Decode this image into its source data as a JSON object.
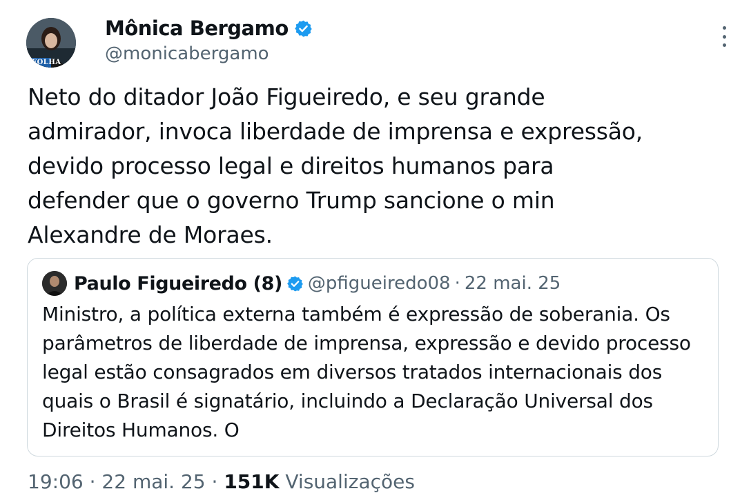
{
  "author": {
    "display_name": "Mônica Bergamo",
    "handle": "@monicabergamo",
    "avatar_badge": "FOLHA",
    "verified_color": "#1d9bf0"
  },
  "tweet": {
    "lines": [
      "Neto do ditador João Figueiredo, e seu grande",
      "admirador, invoca liberdade de imprensa e expressão,",
      "devido processo legal e direitos humanos para",
      "defender que o governo Trump sancione o min",
      "Alexandre de Moraes."
    ]
  },
  "quote": {
    "display_name": "Paulo Figueiredo (8)",
    "handle": "@pfigueiredo08",
    "separator": "·",
    "date": "22 mai. 25",
    "lines": [
      "Ministro, a política externa também é expressão de soberania. Os",
      "parâmetros de liberdade de imprensa, expressão e devido processo",
      "legal estão consagrados em diversos tratados internacionais dos",
      "quais o Brasil é signatário, incluindo a Declaração Universal dos",
      "Direitos Humanos. O"
    ]
  },
  "meta": {
    "time": "19:06",
    "separator": "·",
    "date": "22 mai. 25",
    "views_count": "151K",
    "views_label": "Visualizações"
  }
}
